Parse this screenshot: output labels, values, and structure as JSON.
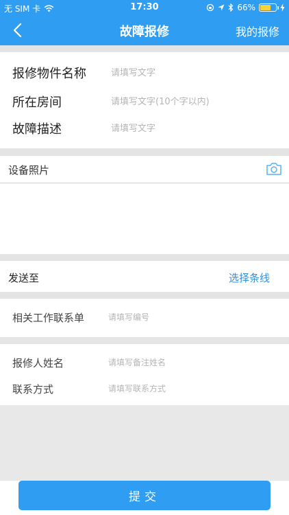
{
  "status_bar": {
    "carrier": "无 SIM 卡",
    "time": "17:30",
    "battery": "66%",
    "battery_level": 0.66
  },
  "nav": {
    "title": "故障报修",
    "right_link": "我的报修"
  },
  "form": {
    "item_name": {
      "label": "报修物件名称",
      "placeholder": "请填写文字"
    },
    "room": {
      "label": "所在房间",
      "placeholder": "请填写文字(10个字以内)"
    },
    "fault": {
      "label": "故障描述",
      "placeholder": "请填写文字"
    }
  },
  "photos": {
    "label": "设备照片"
  },
  "send_to": {
    "label": "发送至",
    "action": "选择条线"
  },
  "work_order": {
    "label": "相关工作联系单",
    "placeholder": "请填写编号"
  },
  "reporter": {
    "name": {
      "label": "报修人姓名",
      "placeholder": "请填写备注姓名"
    },
    "contact": {
      "label": "联系方式",
      "placeholder": "请填写联系方式"
    }
  },
  "submit": {
    "label": "提交"
  },
  "colors": {
    "primary": "#2f9ef2",
    "link": "#2f8fe0",
    "background": "#e8e8e8"
  }
}
